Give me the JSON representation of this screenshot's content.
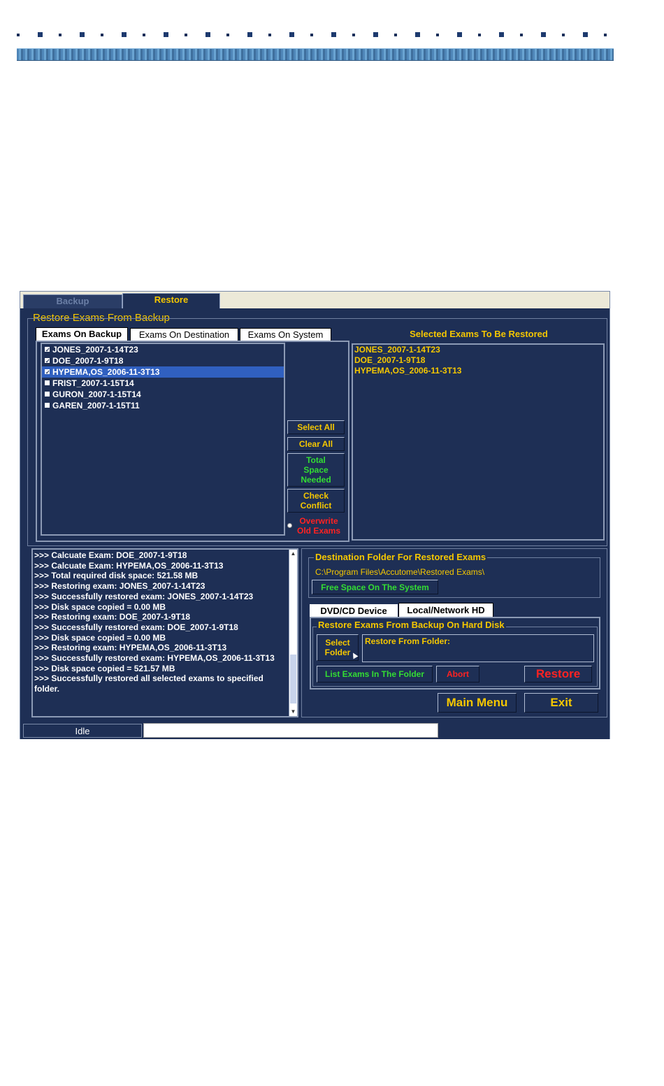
{
  "tabs": {
    "backup": "Backup",
    "restore": "Restore"
  },
  "title": "Restore Exams From Backup",
  "list_tabs": [
    "Exams On Backup",
    "Exams On Destination",
    "Exams On System"
  ],
  "exams": [
    {
      "name": "JONES_2007-1-14T23",
      "checked": true,
      "selected": false
    },
    {
      "name": "DOE_2007-1-9T18",
      "checked": true,
      "selected": false
    },
    {
      "name": "HYPEMA,OS_2006-11-3T13",
      "checked": true,
      "selected": true
    },
    {
      "name": "FRIST_2007-1-15T14",
      "checked": false,
      "selected": false
    },
    {
      "name": "GURON_2007-1-15T14",
      "checked": false,
      "selected": false
    },
    {
      "name": "GAREN_2007-1-15T11",
      "checked": false,
      "selected": false
    }
  ],
  "buttons": {
    "select_all": "Select All",
    "clear_all": "Clear All",
    "total_space": "Total Space Needed",
    "check_conflict": "Check Conflict",
    "overwrite": "Overwrite Old Exams",
    "free_space": "Free Space On The System",
    "select_folder": "Select Folder",
    "list_exams": "List Exams In The Folder",
    "abort": "Abort",
    "restore": "Restore",
    "main_menu": "Main Menu",
    "exit": "Exit"
  },
  "selected_header": "Selected Exams To Be Restored",
  "selected_exams": [
    "JONES_2007-1-14T23",
    "DOE_2007-1-9T18",
    "HYPEMA,OS_2006-11-3T13"
  ],
  "log": [
    ">>> Calcuate Exam: DOE_2007-1-9T18",
    ">>> Calcuate Exam: HYPEMA,OS_2006-11-3T13",
    ">>> Total required disk space: 521.58 MB",
    ">>> Restoring exam: JONES_2007-1-14T23",
    ">>> Successfully restored exam: JONES_2007-1-14T23",
    ">>> Disk space copied = 0.00 MB",
    ">>> Restoring exam: DOE_2007-1-9T18",
    ">>> Successfully restored exam: DOE_2007-1-9T18",
    ">>> Disk space copied = 0.00 MB",
    ">>> Restoring exam: HYPEMA,OS_2006-11-3T13",
    ">>> Successfully restored exam: HYPEMA,OS_2006-11-3T13",
    ">>> Disk space copied = 521.57 MB",
    ">>> Successfully restored all selected exams to specified folder."
  ],
  "destination": {
    "title": "Destination Folder For Restored Exams",
    "path": "C:\\Program Files\\Accutome\\Restored Exams\\"
  },
  "device_tabs": {
    "dvd": "DVD/CD Device",
    "local": "Local/Network HD"
  },
  "harddisk": {
    "title": "Restore Exams From Backup On Hard Disk",
    "folder_label": "Restore From Folder:"
  },
  "status": {
    "text": "Idle"
  },
  "colors": {
    "panel": "#1e2f55",
    "gold": "#f5c700",
    "green": "#33dd33",
    "red": "#ff2222",
    "selection": "#3060c0"
  }
}
